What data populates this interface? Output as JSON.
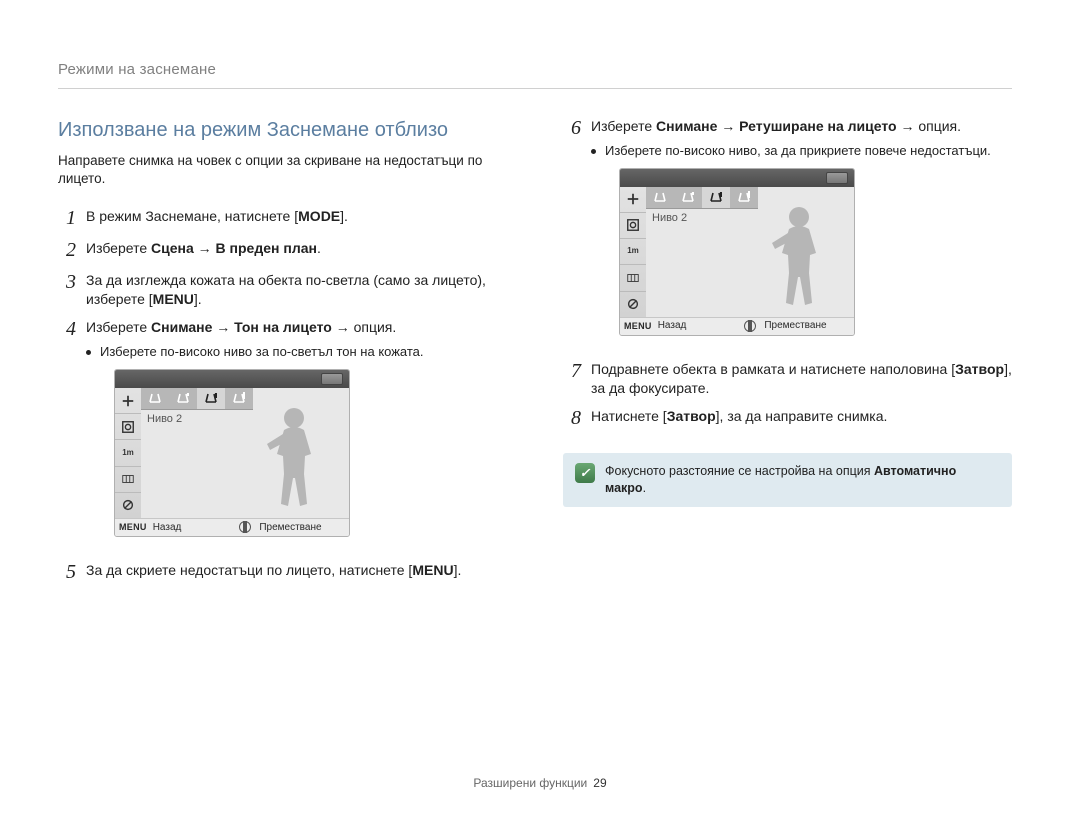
{
  "header": {
    "running": "Режими на заснемане"
  },
  "title": "Използване на режим Заснемане отблизо",
  "intro": "Направете снимка на човек с опции за скриване на недостатъци по лицето.",
  "arrow": " → ",
  "buttons": {
    "mode": "MODE",
    "menu": "MENU",
    "shutter": "Затвор"
  },
  "steps": {
    "s1": {
      "num": "1",
      "pre": "В режим Заснемане, натиснете [",
      "btn": "MODE",
      "post": "]."
    },
    "s2": {
      "num": "2",
      "lead": "Изберете ",
      "a": "Сцена",
      "b": "В преден план",
      "tail": "."
    },
    "s3": {
      "num": "3",
      "pre": "За да изглежда кожата на обекта по-светла (само за лицето), изберете [",
      "btn": "MENU",
      "post": "]."
    },
    "s4": {
      "num": "4",
      "lead": "Изберете ",
      "a": "Снимане",
      "b": "Тон на лицето",
      "opt": "опция",
      "tail": ".",
      "bullet": "Изберете по-високо ниво за по-светъл тон на кожата."
    },
    "s5": {
      "num": "5",
      "pre": "За да скриете недостатъци по лицето, натиснете [",
      "btn": "MENU",
      "post": "]."
    },
    "s6": {
      "num": "6",
      "lead": "Изберете ",
      "a": "Снимане",
      "b": "Ретуширане на лицето",
      "opt": "опция",
      "tail": ".",
      "bullet": "Изберете по-високо ниво, за да прикриете повече недостатъци."
    },
    "s7": {
      "num": "7",
      "pre": "Подравнете обекта в рамката и натиснете наполовина [",
      "btn": "Затвор",
      "post": "], за да фокусирате."
    },
    "s8": {
      "num": "8",
      "pre": "Натиснете [",
      "btn": "Затвор",
      "post": "], за да направите снимка."
    }
  },
  "lcd": {
    "level_label": "Ниво 2",
    "bottom": {
      "menu": "MENU",
      "back": "Назад",
      "move": "Преместване"
    },
    "side_labels": [
      "exposure",
      "face",
      "1m",
      "grid",
      "off"
    ],
    "levels": [
      "0",
      "1",
      "2",
      "3"
    ]
  },
  "note": {
    "text_pre": "Фокусното разстояние се настройва на опция ",
    "bold": "Автоматично макро",
    "text_post": "."
  },
  "footer": {
    "section": "Разширени функции",
    "page": "29"
  }
}
